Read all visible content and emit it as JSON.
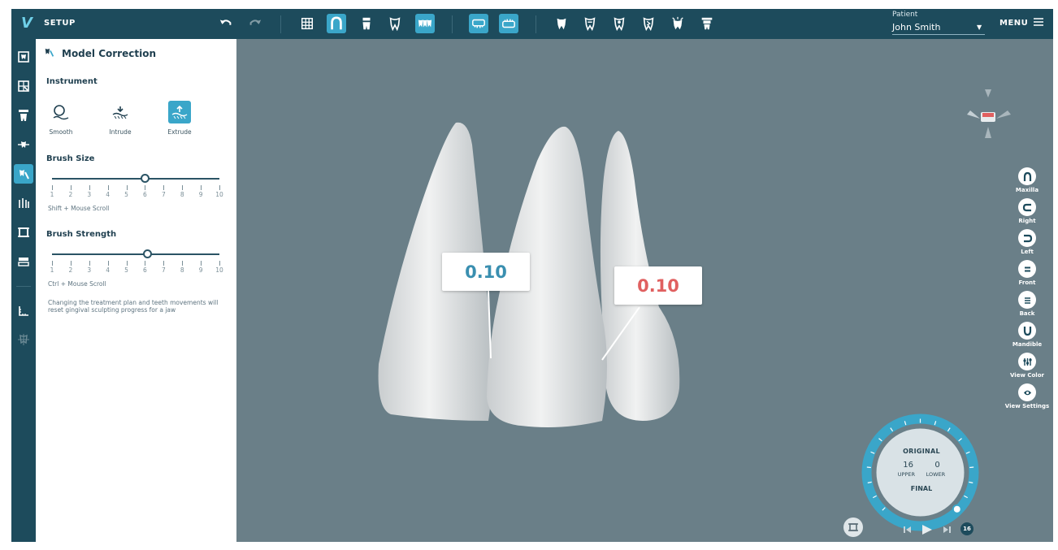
{
  "app": {
    "logo_text": "V",
    "title": "SETUP"
  },
  "toolbar": {
    "undo_icon": "undo-icon",
    "redo_icon": "redo-icon",
    "menu_label": "MENU"
  },
  "patient": {
    "label": "Patient",
    "name": "John Smith"
  },
  "panel": {
    "title": "Model Correction",
    "instrument_heading": "Instrument",
    "tools": [
      {
        "label": "Smooth",
        "icon": "smooth-brush-icon",
        "active": false
      },
      {
        "label": "Intrude",
        "icon": "intrude-brush-icon",
        "active": false
      },
      {
        "label": "Extrude",
        "icon": "extrude-brush-icon",
        "active": true
      }
    ],
    "brush_size": {
      "heading": "Brush Size",
      "value": 6,
      "min": 1,
      "max": 10,
      "hint": "Shift + Mouse Scroll"
    },
    "brush_strength": {
      "heading": "Brush Strength",
      "value": 6.1,
      "min": 1,
      "max": 10,
      "hint": "Ctrl + Mouse Scroll"
    },
    "ticks": [
      "1",
      "2",
      "3",
      "4",
      "5",
      "6",
      "7",
      "8",
      "9",
      "10"
    ],
    "note": "Changing the treatment plan and teeth movements will reset gingival sculpting progress for a jaw"
  },
  "measurements": [
    {
      "value": "0.10",
      "color": "#3a8fb0"
    },
    {
      "value": "0.10",
      "color": "#e06060"
    }
  ],
  "view_buttons": [
    {
      "label": "Maxilla",
      "icon": "maxilla-view-icon"
    },
    {
      "label": "Right",
      "icon": "right-view-icon"
    },
    {
      "label": "Left",
      "icon": "left-view-icon"
    },
    {
      "label": "Front",
      "icon": "front-view-icon"
    },
    {
      "label": "Back",
      "icon": "back-view-icon"
    },
    {
      "label": "Mandible",
      "icon": "mandible-view-icon"
    },
    {
      "label": "View Color",
      "icon": "view-color-icon"
    },
    {
      "label": "View Settings",
      "icon": "view-settings-icon"
    }
  ],
  "stage_dial": {
    "top_label": "ORIGINAL",
    "upper_value": "16",
    "upper_label": "UPPER",
    "lower_value": "0",
    "lower_label": "LOWER",
    "bottom_label": "FINAL",
    "badge": "16",
    "progress": 1.0
  },
  "colors": {
    "accent": "#3aa6c9",
    "navbar": "#1d4b5c",
    "viewport": "#6a7f88"
  }
}
